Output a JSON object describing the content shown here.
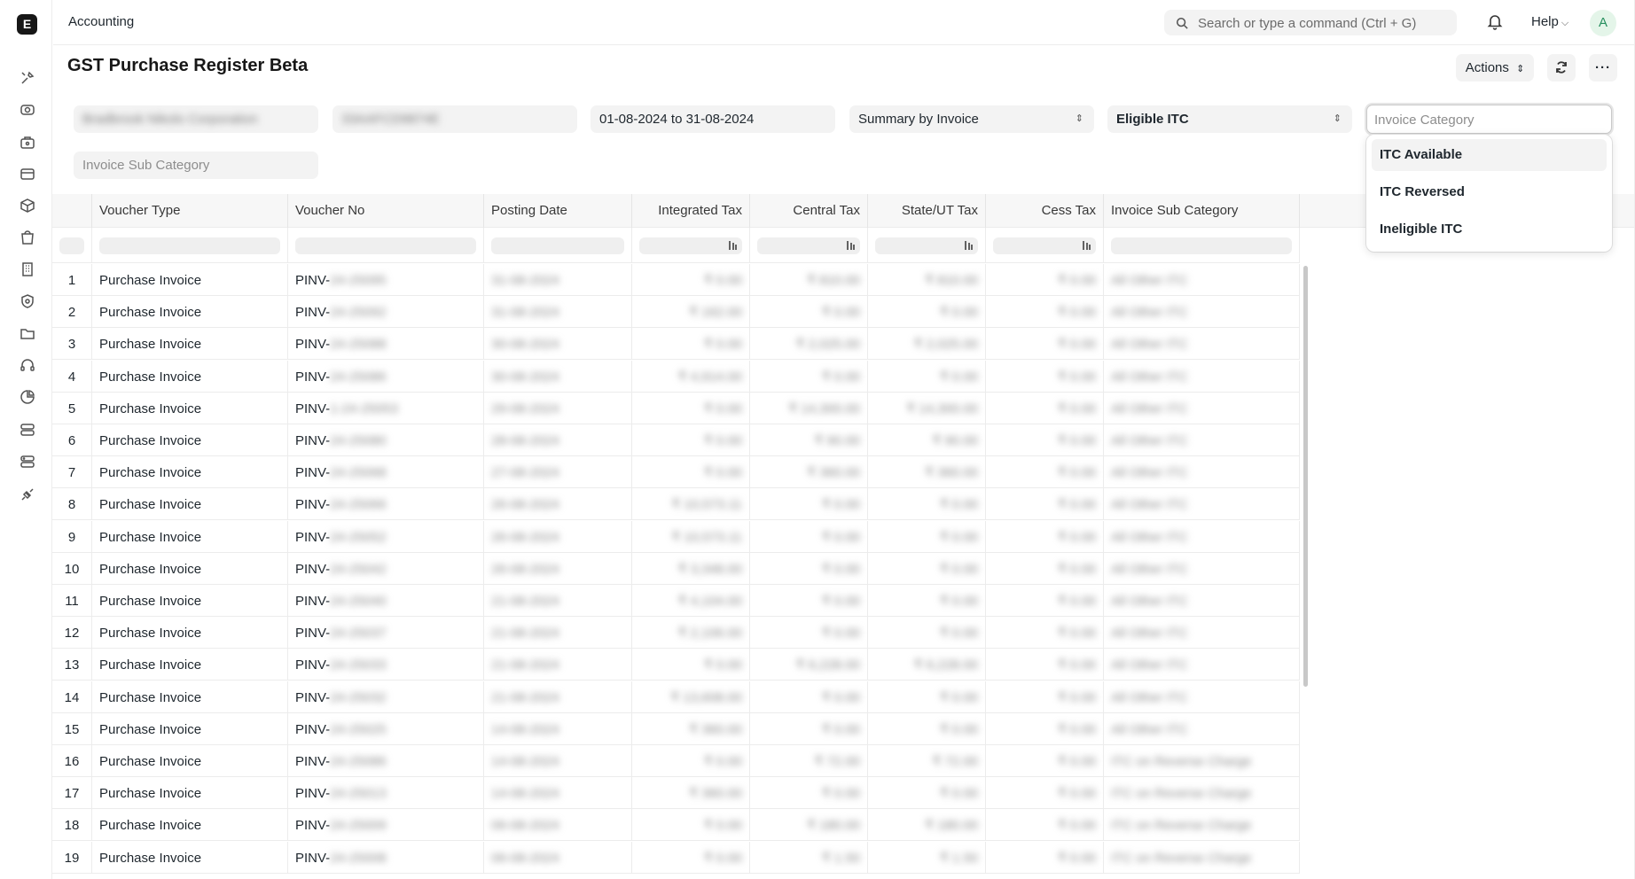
{
  "sidebar": {
    "logo": "E",
    "icons": [
      "tools-icon",
      "budget-icon",
      "briefcase-icon",
      "credit-card-icon",
      "box-icon",
      "shopping-bag-icon",
      "building-icon",
      "shield-icon",
      "folder-icon",
      "headset-icon",
      "pie-chart-icon",
      "server-icon",
      "server-stack-icon",
      "plug-icon"
    ]
  },
  "topbar": {
    "breadcrumb": "Accounting",
    "search_placeholder": "Search or type a command (Ctrl + G)",
    "help": "Help",
    "avatar_initial": "A"
  },
  "page": {
    "title": "GST Purchase Register Beta",
    "actions_label": "Actions",
    "actions_arrows": "⌃"
  },
  "filters": {
    "company": "Bradbrook Nikolo Corporation",
    "gstin": "33AAFCD9874E",
    "date_range": "01-08-2024 to 31-08-2024",
    "summary_type": "Summary by Invoice",
    "sub_return": "Eligible ITC",
    "invoice_category_placeholder": "Invoice Category",
    "invoice_sub_category_placeholder": "Invoice Sub Category"
  },
  "dropdown": {
    "options": [
      "ITC Available",
      "ITC Reversed",
      "Ineligible ITC"
    ]
  },
  "table": {
    "columns": [
      "Voucher Type",
      "Voucher No",
      "Posting Date",
      "Integrated Tax",
      "Central Tax",
      "State/UT Tax",
      "Cess Tax",
      "Invoice Sub Category"
    ],
    "voucher_prefix": "PINV-",
    "rows": [
      {
        "n": "1",
        "type": "Purchase Invoice",
        "no": "24-25095",
        "date": "31-08-2024",
        "igst": "₹ 0.00",
        "cgst": "₹ 810.00",
        "sgst": "₹ 810.00",
        "cess": "₹ 0.00",
        "sub": "All Other ITC"
      },
      {
        "n": "2",
        "type": "Purchase Invoice",
        "no": "24-25092",
        "date": "31-08-2024",
        "igst": "₹ 162.00",
        "cgst": "₹ 0.00",
        "sgst": "₹ 0.00",
        "cess": "₹ 0.00",
        "sub": "All Other ITC"
      },
      {
        "n": "3",
        "type": "Purchase Invoice",
        "no": "24-25088",
        "date": "30-08-2024",
        "igst": "₹ 0.00",
        "cgst": "₹ 2,025.00",
        "sgst": "₹ 2,025.00",
        "cess": "₹ 0.00",
        "sub": "All Other ITC"
      },
      {
        "n": "4",
        "type": "Purchase Invoice",
        "no": "24-25086",
        "date": "30-08-2024",
        "igst": "₹ 4,914.00",
        "cgst": "₹ 0.00",
        "sgst": "₹ 0.00",
        "cess": "₹ 0.00",
        "sub": "All Other ITC"
      },
      {
        "n": "5",
        "type": "Purchase Invoice",
        "no": "1-24-25053",
        "date": "29-08-2024",
        "igst": "₹ 0.00",
        "cgst": "₹ 14,300.00",
        "sgst": "₹ 14,300.00",
        "cess": "₹ 0.00",
        "sub": "All Other ITC"
      },
      {
        "n": "6",
        "type": "Purchase Invoice",
        "no": "24-25080",
        "date": "28-08-2024",
        "igst": "₹ 0.00",
        "cgst": "₹ 90.00",
        "sgst": "₹ 90.00",
        "cess": "₹ 0.00",
        "sub": "All Other ITC"
      },
      {
        "n": "7",
        "type": "Purchase Invoice",
        "no": "24-25068",
        "date": "27-08-2024",
        "igst": "₹ 0.00",
        "cgst": "₹ 360.00",
        "sgst": "₹ 360.00",
        "cess": "₹ 0.00",
        "sub": "All Other ITC"
      },
      {
        "n": "8",
        "type": "Purchase Invoice",
        "no": "24-25066",
        "date": "26-08-2024",
        "igst": "₹ 10,573.11",
        "cgst": "₹ 0.00",
        "sgst": "₹ 0.00",
        "cess": "₹ 0.00",
        "sub": "All Other ITC"
      },
      {
        "n": "9",
        "type": "Purchase Invoice",
        "no": "24-25052",
        "date": "26-08-2024",
        "igst": "₹ 10,573.11",
        "cgst": "₹ 0.00",
        "sgst": "₹ 0.00",
        "cess": "₹ 0.00",
        "sub": "All Other ITC"
      },
      {
        "n": "10",
        "type": "Purchase Invoice",
        "no": "24-25042",
        "date": "26-08-2024",
        "igst": "₹ 3,348.00",
        "cgst": "₹ 0.00",
        "sgst": "₹ 0.00",
        "cess": "₹ 0.00",
        "sub": "All Other ITC"
      },
      {
        "n": "11",
        "type": "Purchase Invoice",
        "no": "24-25040",
        "date": "21-08-2024",
        "igst": "₹ 4,104.00",
        "cgst": "₹ 0.00",
        "sgst": "₹ 0.00",
        "cess": "₹ 0.00",
        "sub": "All Other ITC"
      },
      {
        "n": "12",
        "type": "Purchase Invoice",
        "no": "24-25037",
        "date": "21-08-2024",
        "igst": "₹ 2,106.00",
        "cgst": "₹ 0.00",
        "sgst": "₹ 0.00",
        "cess": "₹ 0.00",
        "sub": "All Other ITC"
      },
      {
        "n": "13",
        "type": "Purchase Invoice",
        "no": "24-25033",
        "date": "21-08-2024",
        "igst": "₹ 0.00",
        "cgst": "₹ 6,228.00",
        "sgst": "₹ 6,228.00",
        "cess": "₹ 0.00",
        "sub": "All Other ITC"
      },
      {
        "n": "14",
        "type": "Purchase Invoice",
        "no": "24-25032",
        "date": "21-08-2024",
        "igst": "₹ 13,608.00",
        "cgst": "₹ 0.00",
        "sgst": "₹ 0.00",
        "cess": "₹ 0.00",
        "sub": "All Other ITC"
      },
      {
        "n": "15",
        "type": "Purchase Invoice",
        "no": "24-25025",
        "date": "14-08-2024",
        "igst": "₹ 360.00",
        "cgst": "₹ 0.00",
        "sgst": "₹ 0.00",
        "cess": "₹ 0.00",
        "sub": "All Other ITC"
      },
      {
        "n": "16",
        "type": "Purchase Invoice",
        "no": "24-25086",
        "date": "14-08-2024",
        "igst": "₹ 0.00",
        "cgst": "₹ 72.00",
        "sgst": "₹ 72.00",
        "cess": "₹ 0.00",
        "sub": "ITC on Reverse Charge"
      },
      {
        "n": "17",
        "type": "Purchase Invoice",
        "no": "24-25013",
        "date": "14-08-2024",
        "igst": "₹ 360.00",
        "cgst": "₹ 0.00",
        "sgst": "₹ 0.00",
        "cess": "₹ 0.00",
        "sub": "ITC on Reverse Charge"
      },
      {
        "n": "18",
        "type": "Purchase Invoice",
        "no": "24-25009",
        "date": "06-08-2024",
        "igst": "₹ 0.00",
        "cgst": "₹ 180.00",
        "sgst": "₹ 180.00",
        "cess": "₹ 0.00",
        "sub": "ITC on Reverse Charge"
      },
      {
        "n": "19",
        "type": "Purchase Invoice",
        "no": "24-25008",
        "date": "06-08-2024",
        "igst": "₹ 0.00",
        "cgst": "₹ 1.50",
        "sgst": "₹ 1.50",
        "cess": "₹ 0.00",
        "sub": "ITC on Reverse Charge"
      }
    ]
  }
}
